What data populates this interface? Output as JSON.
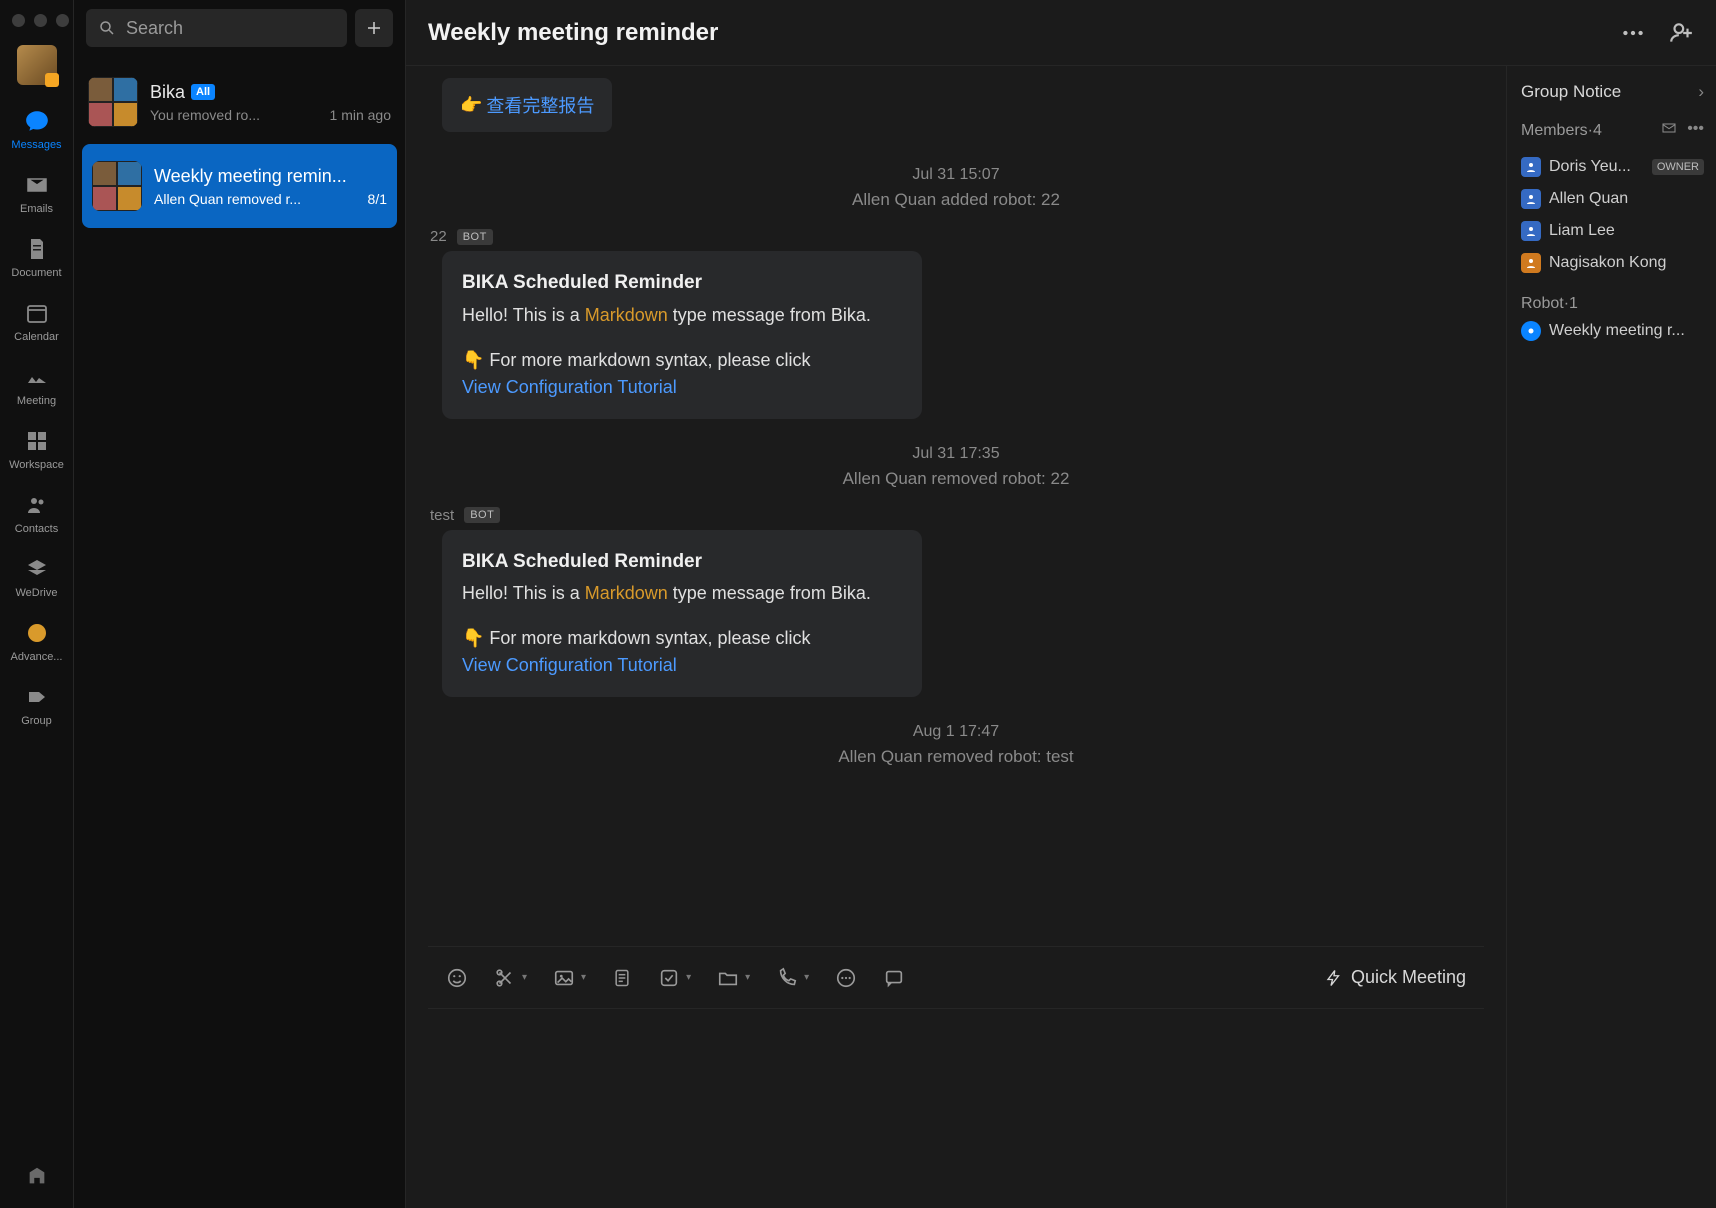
{
  "nav": {
    "items": [
      {
        "id": "messages",
        "label": "Messages",
        "active": true
      },
      {
        "id": "emails",
        "label": "Emails"
      },
      {
        "id": "document",
        "label": "Document"
      },
      {
        "id": "calendar",
        "label": "Calendar"
      },
      {
        "id": "meeting",
        "label": "Meeting"
      },
      {
        "id": "workspace",
        "label": "Workspace"
      },
      {
        "id": "contacts",
        "label": "Contacts"
      },
      {
        "id": "wedrive",
        "label": "WeDrive"
      },
      {
        "id": "advanced",
        "label": "Advance..."
      },
      {
        "id": "group",
        "label": "Group"
      }
    ]
  },
  "search": {
    "placeholder": "Search"
  },
  "conversations": [
    {
      "title": "Bika",
      "badge": "All",
      "preview": "You removed ro...",
      "time": "1 min ago",
      "active": false
    },
    {
      "title": "Weekly meeting remin...",
      "preview": "Allen Quan removed r...",
      "count": "8/1",
      "active": true
    }
  ],
  "chat": {
    "title": "Weekly meeting reminder",
    "top_link": {
      "emoji": "👉",
      "text": "查看完整报告"
    },
    "events": [
      {
        "time": "Jul 31 15:07",
        "text": "Allen Quan added robot: 22"
      },
      {
        "time": "Jul 31 17:35",
        "text": "Allen Quan removed robot: 22"
      },
      {
        "time": "Aug 1 17:47",
        "text": "Allen Quan removed robot: test"
      }
    ],
    "bots": [
      {
        "name": "22",
        "tag": "BOT",
        "card": {
          "title": "BIKA Scheduled Reminder",
          "prefix": "Hello! This is a ",
          "kw": "Markdown",
          "suffix": " type message from Bika.",
          "hint": "👇 For more markdown syntax, please click",
          "link": "View Configuration Tutorial"
        }
      },
      {
        "name": "test",
        "tag": "BOT",
        "card": {
          "title": "BIKA Scheduled Reminder",
          "prefix": "Hello! This is a ",
          "kw": "Markdown",
          "suffix": " type message from Bika.",
          "hint": "👇 For more markdown syntax, please click",
          "link": "View Configuration Tutorial"
        }
      }
    ],
    "quick_meeting": "Quick Meeting"
  },
  "side": {
    "group_notice": "Group Notice",
    "members_label": "Members·4",
    "members": [
      {
        "name": "Doris Yeu...",
        "owner": true,
        "owner_label": "OWNER",
        "color": "blue"
      },
      {
        "name": "Allen Quan",
        "color": "blue"
      },
      {
        "name": "Liam Lee",
        "color": "blue"
      },
      {
        "name": "Nagisakon Kong",
        "color": "orange"
      }
    ],
    "robot_label": "Robot·1",
    "robots": [
      {
        "name": "Weekly meeting r..."
      }
    ]
  }
}
